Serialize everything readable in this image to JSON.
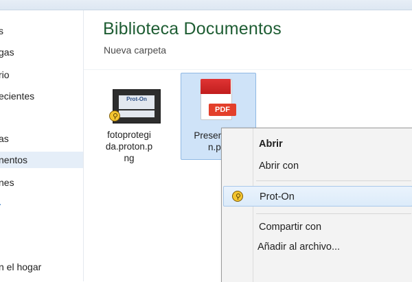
{
  "sidebar": {
    "items": [
      {
        "label": "s"
      },
      {
        "label": "gas"
      },
      {
        "label": "rio"
      },
      {
        "label": "ecientes"
      },
      {
        "label": "as"
      },
      {
        "label": "nentos"
      },
      {
        "label": "nes"
      },
      {
        "label": "·"
      },
      {
        "label": "n el hogar"
      }
    ]
  },
  "library": {
    "title": "Biblioteca Documentos",
    "subtitle": "Nueva carpeta"
  },
  "files": [
    {
      "name_lines": [
        "fotoprotegi",
        "da.proton.p",
        "ng"
      ],
      "icon": "image-thumbnail",
      "thumb_text": "Prot-On"
    },
    {
      "name_lines": [
        "Presentació",
        "n.pdf"
      ],
      "icon": "pdf-icon",
      "badge": "PDF"
    }
  ],
  "context_menu": {
    "items": [
      {
        "label": "Abrir"
      },
      {
        "label": "Abrir con"
      },
      {
        "label": "Prot-On"
      },
      {
        "label": "Compartir con"
      },
      {
        "label": "Añadir al archivo..."
      }
    ]
  },
  "colors": {
    "title_green": "#1e5d33",
    "selection_blue": "#cfe3f8",
    "pdf_red": "#e33f2a",
    "prot_on_yellow": "#f4c530"
  }
}
